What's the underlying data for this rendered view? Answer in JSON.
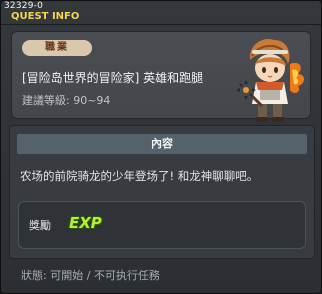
{
  "window": {
    "id": "32329-0",
    "title": "QUEST INFO"
  },
  "quest": {
    "job_badge": "職業",
    "name": "[冒险岛世界的冒险家] 英雄和跑腿",
    "level": "建議等級: 90~94",
    "npc_portrait": "hero-npc-portrait"
  },
  "content": {
    "header": "內容",
    "text": "农场的前院骑龙的少年登场了! 和龙神聊聊吧。"
  },
  "reward": {
    "label": "獎勵",
    "icon": "exp-icon",
    "icon_text": "EXP"
  },
  "status": {
    "text": "狀態: 可開始 / 不可执行任務"
  },
  "colors": {
    "title": "#f5d54a",
    "exp": "#b6ef34",
    "badge_bg": "#d9c7ae",
    "badge_text": "#6a3a18"
  }
}
